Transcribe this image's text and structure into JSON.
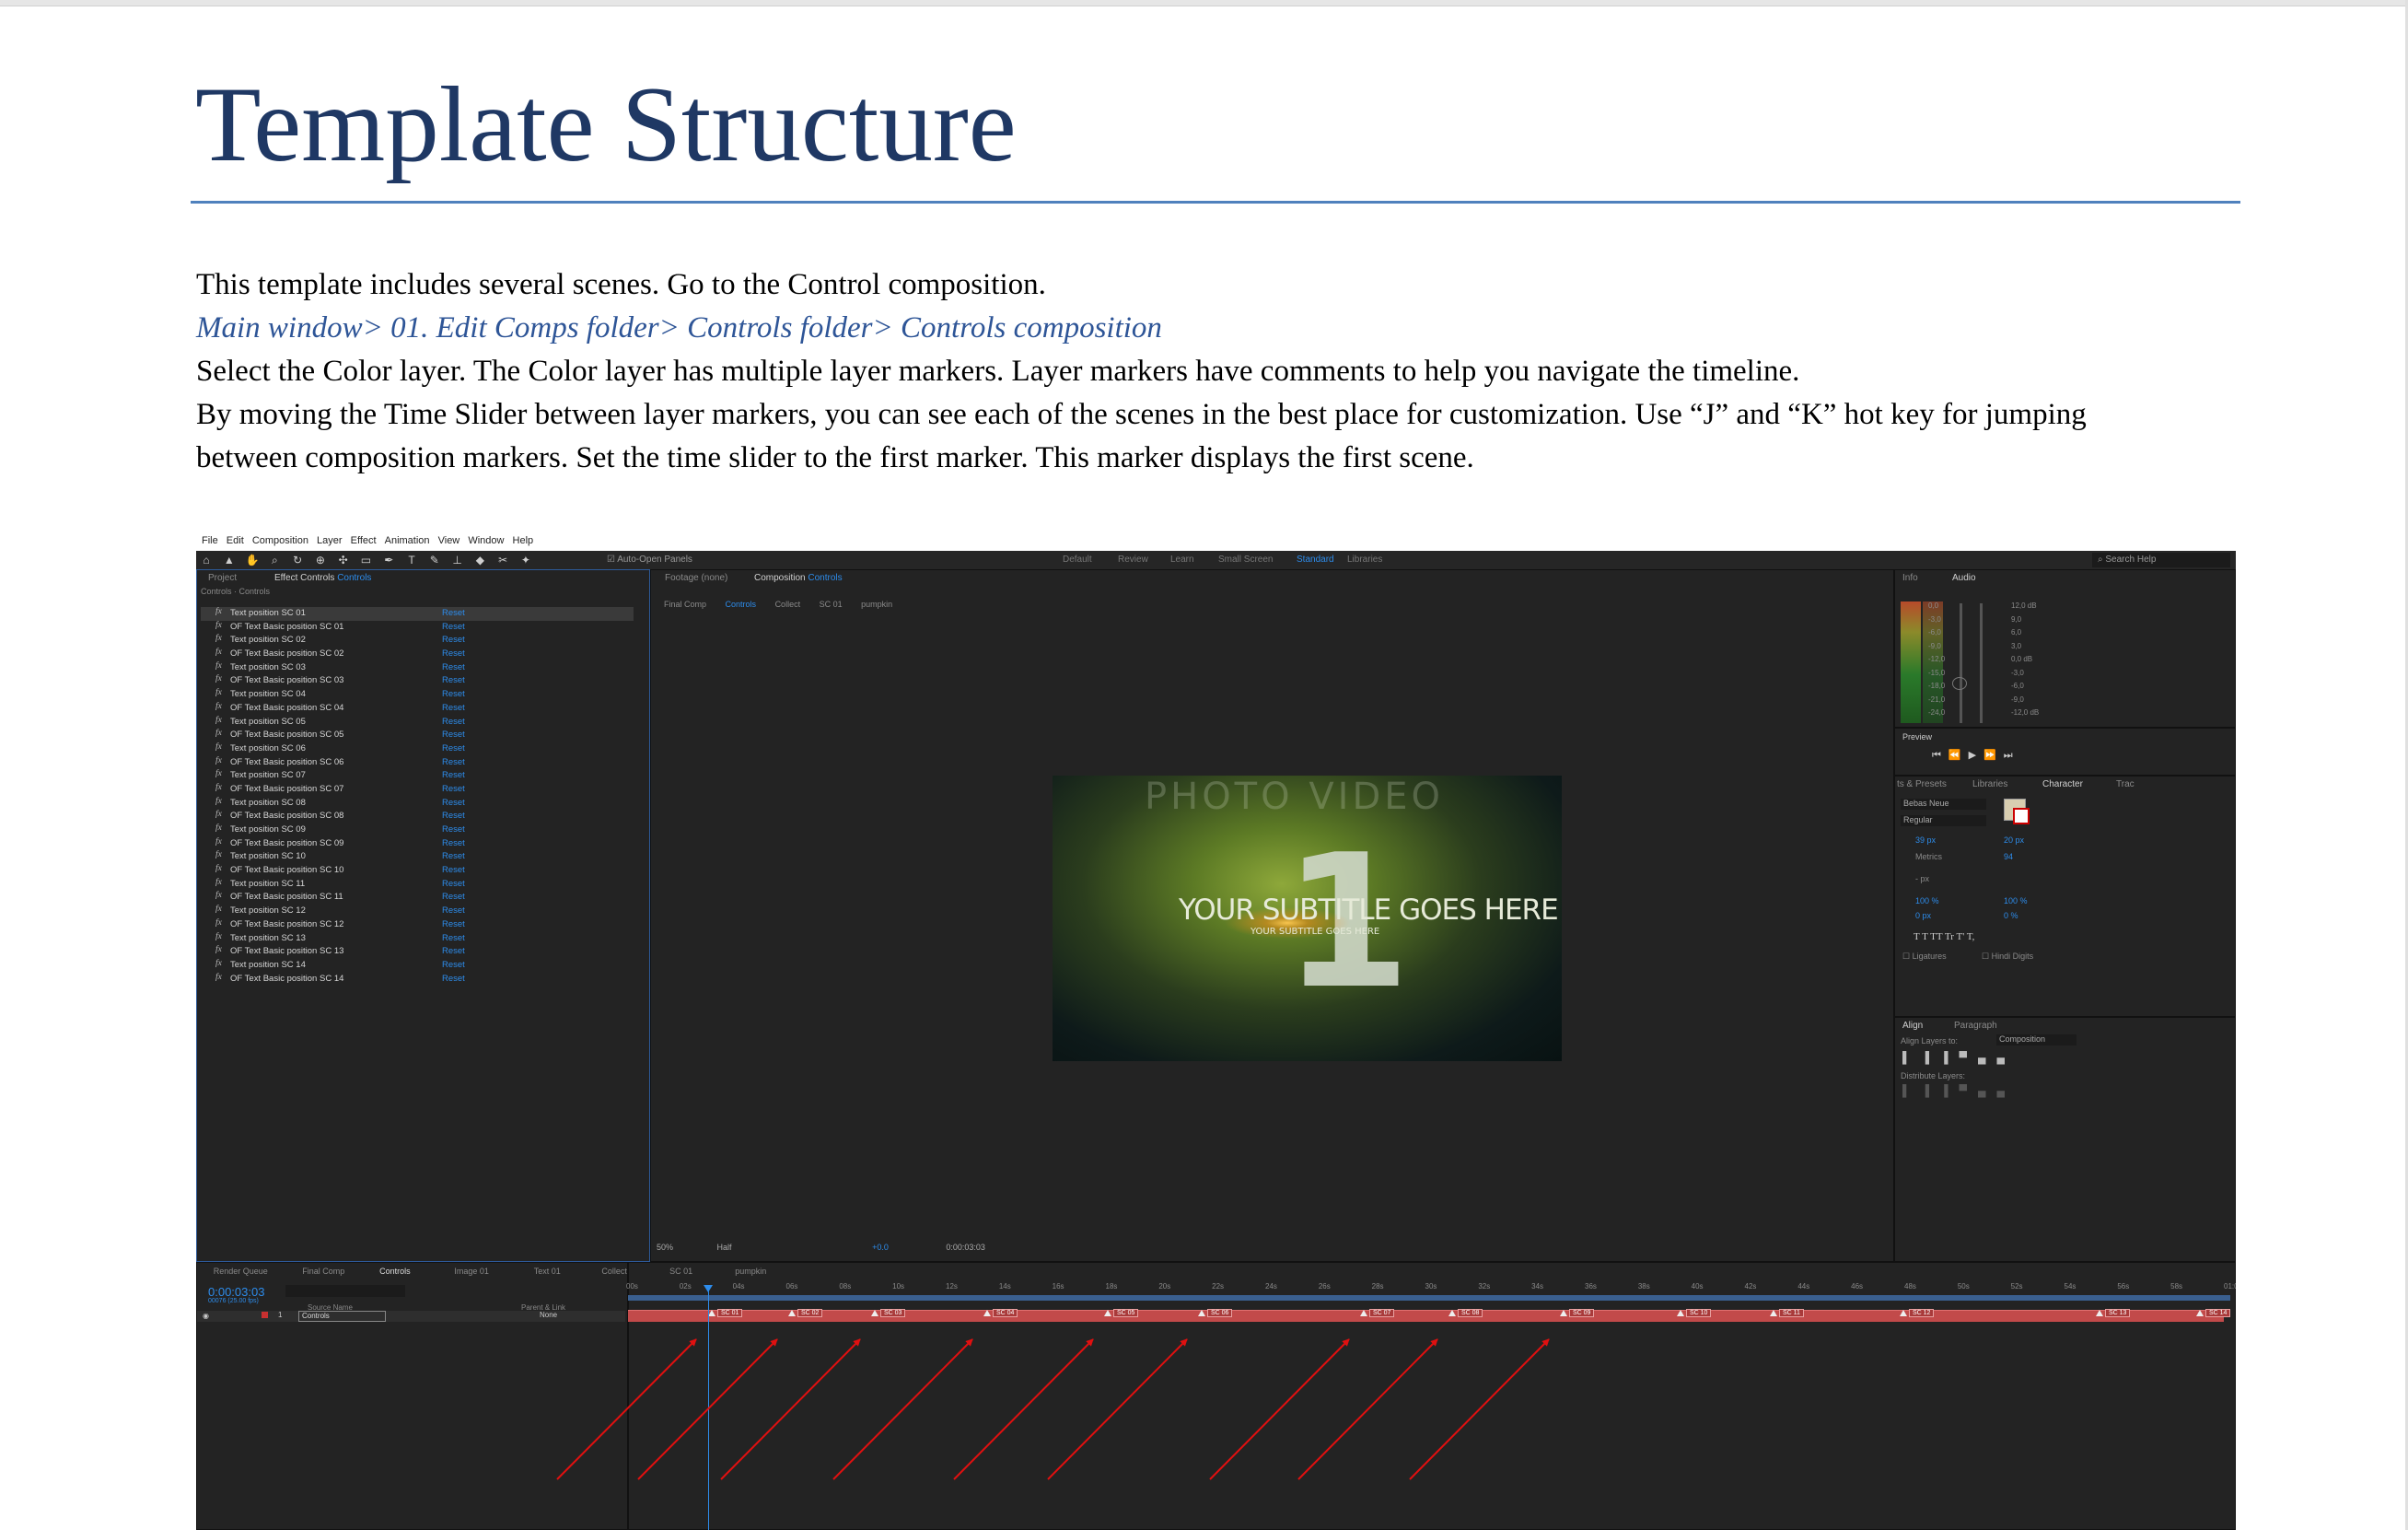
{
  "document": {
    "title": "Template Structure",
    "paragraphs": {
      "p1": "This template includes several scenes. Go to the Control composition.",
      "p2": "Main window> 01. Edit Comps folder> Controls folder> Controls composition",
      "p3": "Select the Color layer. The Color layer has multiple layer markers. Layer markers have comments to help you navigate the timeline.",
      "p4a": "By moving the Time Slider between layer markers, you can see each of the scenes in the best place for customization. Use “J” and “K” hot key for jumping",
      "p4b": "between composition markers. Set the time slider to the first marker. This marker displays the first scene."
    }
  },
  "screenshot": {
    "menu": [
      "File",
      "Edit",
      "Composition",
      "Layer",
      "Effect",
      "Animation",
      "View",
      "Window",
      "Help"
    ],
    "auto_open": "Auto-Open Panels",
    "workspaces": [
      "Default",
      "Review",
      "Learn",
      "Small Screen",
      "Standard",
      "Libraries"
    ],
    "search_help": "Search Help",
    "left_panel": {
      "tab_project": "Project",
      "tab_effect": "Effect Controls",
      "tab_effect_target": "Controls",
      "header": "Controls · Controls",
      "reset": "Reset",
      "effects": [
        "Text position SC 01",
        "OF Text Basic position SC 01",
        "Text position SC 02",
        "OF Text Basic position SC 02",
        "Text position SC 03",
        "OF Text Basic position SC 03",
        "Text position SC 04",
        "OF Text Basic position SC 04",
        "Text position SC 05",
        "OF Text Basic position SC 05",
        "Text position SC 06",
        "OF Text Basic position SC 06",
        "Text position SC 07",
        "OF Text Basic position SC 07",
        "Text position SC 08",
        "OF Text Basic position SC 08",
        "Text position SC 09",
        "OF Text Basic position SC 09",
        "Text position SC 10",
        "OF Text Basic position SC 10",
        "Text position SC 11",
        "OF Text Basic position SC 11",
        "Text position SC 12",
        "OF Text Basic position SC 12",
        "Text position SC 13",
        "OF Text Basic position SC 13",
        "Text position SC 14",
        "OF Text Basic position SC 14"
      ]
    },
    "viewer_panel": {
      "tab_footage": "Footage (none)",
      "tab_comp": "Composition",
      "tab_comp_target": "Controls",
      "crumbs": [
        "Final Comp",
        "Controls",
        "Collect",
        "SC 01",
        "pumpkin"
      ],
      "frame_subtitle": "YOUR SUBTITLE GOES HERE",
      "frame_subtitle_small": "YOUR SUBTITLE GOES HERE",
      "frame_number": "1",
      "frame_ghost": "PHOTO VIDEO",
      "zoom": "50%",
      "resolution": "Half",
      "exposure": "+0.0",
      "timecode": "0:00:03:03"
    },
    "right_panel": {
      "tab_info": "Info",
      "tab_audio": "Audio",
      "db_left": [
        "0,0",
        "-3,0",
        "-6,0",
        "-9,0",
        "-12,0",
        "-15,0",
        "-18,0",
        "-21,0",
        "-24,0"
      ],
      "db_right": [
        "12,0 dB",
        "9,0",
        "6,0",
        "3,0",
        "0,0 dB",
        "-3,0",
        "-6,0",
        "-9,0",
        "-12,0 dB"
      ],
      "tab_preview": "Preview",
      "tab_effects": "ts & Presets",
      "tab_libraries": "Libraries",
      "tab_character": "Character",
      "tab_track": "Trac",
      "font": "Bebas Neue",
      "style": "Regular",
      "size": "39 px",
      "leading": "20 px",
      "kerning": "Metrics",
      "tracking": "94",
      "stroke": "- px",
      "vscale": "100 %",
      "hscale": "100 %",
      "baseline": "0 px",
      "tsume": "0 %",
      "type_buttons": "T  T  TT  Tr  T'  T,",
      "ligatures": "Ligatures",
      "hindi": "Hindi Digits",
      "tab_align": "Align",
      "tab_paragraph": "Paragraph",
      "align_to_label": "Align Layers to:",
      "align_to_value": "Composition",
      "distribute": "Distribute Layers:"
    },
    "timeline": {
      "tabs": [
        "Render Queue",
        "Final Comp",
        "Controls",
        "Image 01",
        "Text 01",
        "Collect",
        "SC 01",
        "pumpkin"
      ],
      "timecode": "0:00:03:03",
      "fps": "00076 (25.00 fps)",
      "col_source": "Source Name",
      "col_parent": "Parent & Link",
      "layer_num": "1",
      "layer_name": "Controls",
      "parent_value": "None",
      "ruler": [
        "00s",
        "02s",
        "04s",
        "06s",
        "08s",
        "10s",
        "12s",
        "14s",
        "16s",
        "18s",
        "20s",
        "22s",
        "24s",
        "26s",
        "28s",
        "30s",
        "32s",
        "34s",
        "36s",
        "38s",
        "40s",
        "42s",
        "44s",
        "46s",
        "48s",
        "50s",
        "52s",
        "54s",
        "56s",
        "58s",
        "01:0"
      ],
      "markers": [
        "SC 01",
        "SC 02",
        "SC 03",
        "SC 04",
        "SC 05",
        "SC 06",
        "SC 07",
        "SC 08",
        "SC 09",
        "SC 10",
        "SC 11",
        "SC 12",
        "SC 13",
        "SC 14"
      ]
    }
  },
  "colors": {
    "heading": "#1f3864",
    "link": "#2e5597",
    "rule": "#4f81bd",
    "ae_accent": "#2d8ceb",
    "layer_bar": "#c24a4a",
    "arrow": "#e01010"
  }
}
